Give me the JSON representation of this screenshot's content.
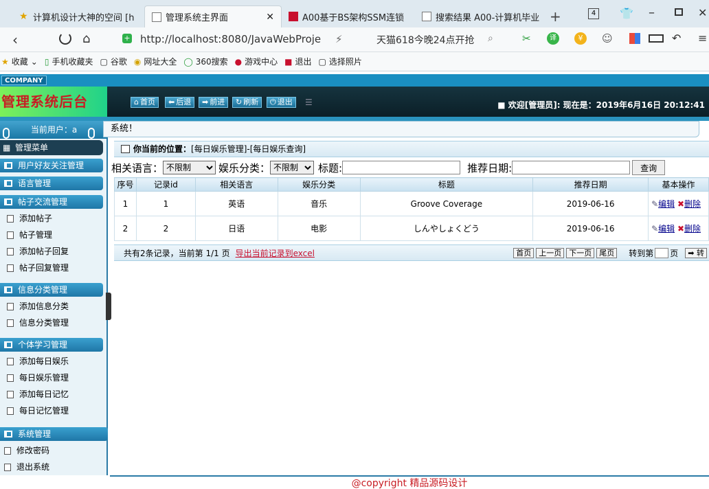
{
  "browser": {
    "tabs": [
      {
        "label": "计算机设计大神的空间 [h",
        "active": false
      },
      {
        "label": "管理系统主界面",
        "active": true
      },
      {
        "label": "A00基于BS架构SSM连锁",
        "active": false
      },
      {
        "label": "搜索结果 A00-计算机毕业",
        "active": false
      }
    ],
    "tab_count": "4",
    "url": "http://localhost:8080/JavaWebProje",
    "search_hint": "天猫618今晚24点开抢",
    "bookmarks": [
      "收藏",
      "手机收藏夹",
      "谷歌",
      "网址大全",
      "360搜索",
      "游戏中心",
      "退出",
      "选择照片"
    ]
  },
  "app": {
    "company": "COMPANY",
    "logo": "管理系统后台",
    "nav": [
      "首页",
      "后退",
      "前进",
      "刷新",
      "退出"
    ],
    "welcome": "欢迎[管理员]:  现在是：2019年6月16日 20:12:41",
    "tip": "系统！"
  },
  "sidebar": {
    "current_user": "当前用户：a",
    "menu_title": "管理菜单",
    "sections": [
      {
        "title": "用户好友关注管理",
        "items": []
      },
      {
        "title": "语言管理",
        "items": []
      },
      {
        "title": "帖子交流管理",
        "items": [
          "添加帖子",
          "帖子管理",
          "添加帖子回复",
          "帖子回复管理"
        ]
      },
      {
        "title": "信息分类管理",
        "items": [
          "添加信息分类",
          "信息分类管理"
        ]
      },
      {
        "title": "个体学习管理",
        "items": [
          "添加每日娱乐",
          "每日娱乐管理",
          "添加每日记忆",
          "每日记忆管理"
        ]
      },
      {
        "title": "系统管理",
        "items": [
          "修改密码",
          "退出系统"
        ]
      }
    ]
  },
  "position": {
    "label": "你当前的位置：",
    "path": "[每日娱乐管理]-[每日娱乐查询]"
  },
  "search": {
    "lang_label": "相关语言：",
    "lang_value": "不限制",
    "cat_label": "娱乐分类：",
    "cat_value": "不限制",
    "title_label": "标题:",
    "title_value": "",
    "date_label": "推荐日期:",
    "date_value": "",
    "query_button": "查询"
  },
  "table": {
    "headers": [
      "序号",
      "记录id",
      "相关语言",
      "娱乐分类",
      "标题",
      "推荐日期",
      "基本操作"
    ],
    "rows": [
      {
        "no": "1",
        "id": "1",
        "lang": "英语",
        "cat": "音乐",
        "title": "Groove Coverage",
        "date": "2019-06-16"
      },
      {
        "no": "2",
        "id": "2",
        "lang": "日语",
        "cat": "电影",
        "title": "しんやしょくどう",
        "date": "2019-06-16"
      }
    ],
    "edit_label": "编辑",
    "delete_label": "删除"
  },
  "pager": {
    "summary": "共有2条记录，当前第 1/1 页",
    "export": "导出当前记录到excel",
    "first": "首页",
    "prev": "上一页",
    "next": "下一页",
    "last": "尾页",
    "goto_label": "转到第",
    "goto_suffix": "页",
    "goto_button": "➡ 转"
  },
  "footer": "@copyright 精品源码设计"
}
